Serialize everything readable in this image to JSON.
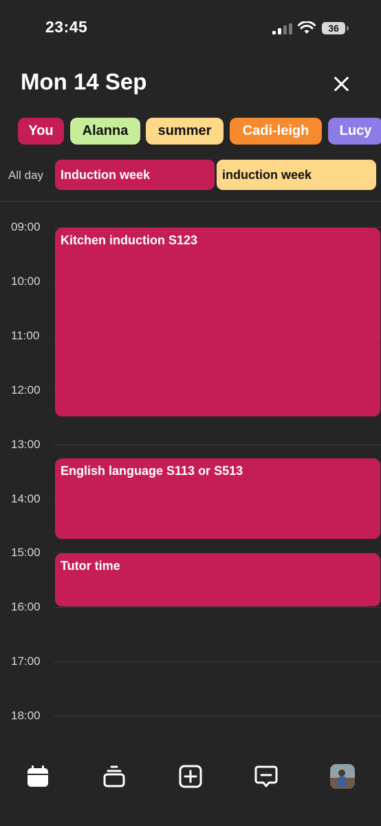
{
  "status_bar": {
    "time": "23:45",
    "battery": "36"
  },
  "header": {
    "title": "Mon 14 Sep"
  },
  "people": [
    {
      "name": "You",
      "color": "#c51e56",
      "text_color": "#ffffff"
    },
    {
      "name": "Alanna",
      "color": "#c6ee9a",
      "text_color": "#111111"
    },
    {
      "name": "summer",
      "color": "#fdd889",
      "text_color": "#111111"
    },
    {
      "name": "Cadi-leigh",
      "color": "#f58a2e",
      "text_color": "#ffffff"
    },
    {
      "name": "Lucy",
      "color": "#8c7ce6",
      "text_color": "#ffffff"
    }
  ],
  "all_day": {
    "label": "All day",
    "events": [
      {
        "title": "Induction week",
        "color": "#c51e56",
        "text_color": "#ffffff"
      },
      {
        "title": "induction week",
        "color": "#fdd889",
        "text_color": "#111111"
      }
    ]
  },
  "timeline": {
    "hours": [
      "09:00",
      "10:00",
      "11:00",
      "12:00",
      "13:00",
      "14:00",
      "15:00",
      "16:00",
      "17:00",
      "18:00"
    ],
    "events": [
      {
        "title": "Kitchen induction S123",
        "start": "09:00",
        "end": "12:30",
        "color": "#c51e56"
      },
      {
        "title": "English language S113 or S513",
        "start": "13:15",
        "end": "14:45",
        "color": "#c51e56"
      },
      {
        "title": "Tutor time",
        "start": "15:00",
        "end": "16:00",
        "color": "#c51e56"
      }
    ]
  },
  "nav": {
    "items": [
      {
        "name": "calendar-icon"
      },
      {
        "name": "stack-icon"
      },
      {
        "name": "add-event-icon"
      },
      {
        "name": "message-icon"
      },
      {
        "name": "profile-avatar"
      }
    ]
  }
}
